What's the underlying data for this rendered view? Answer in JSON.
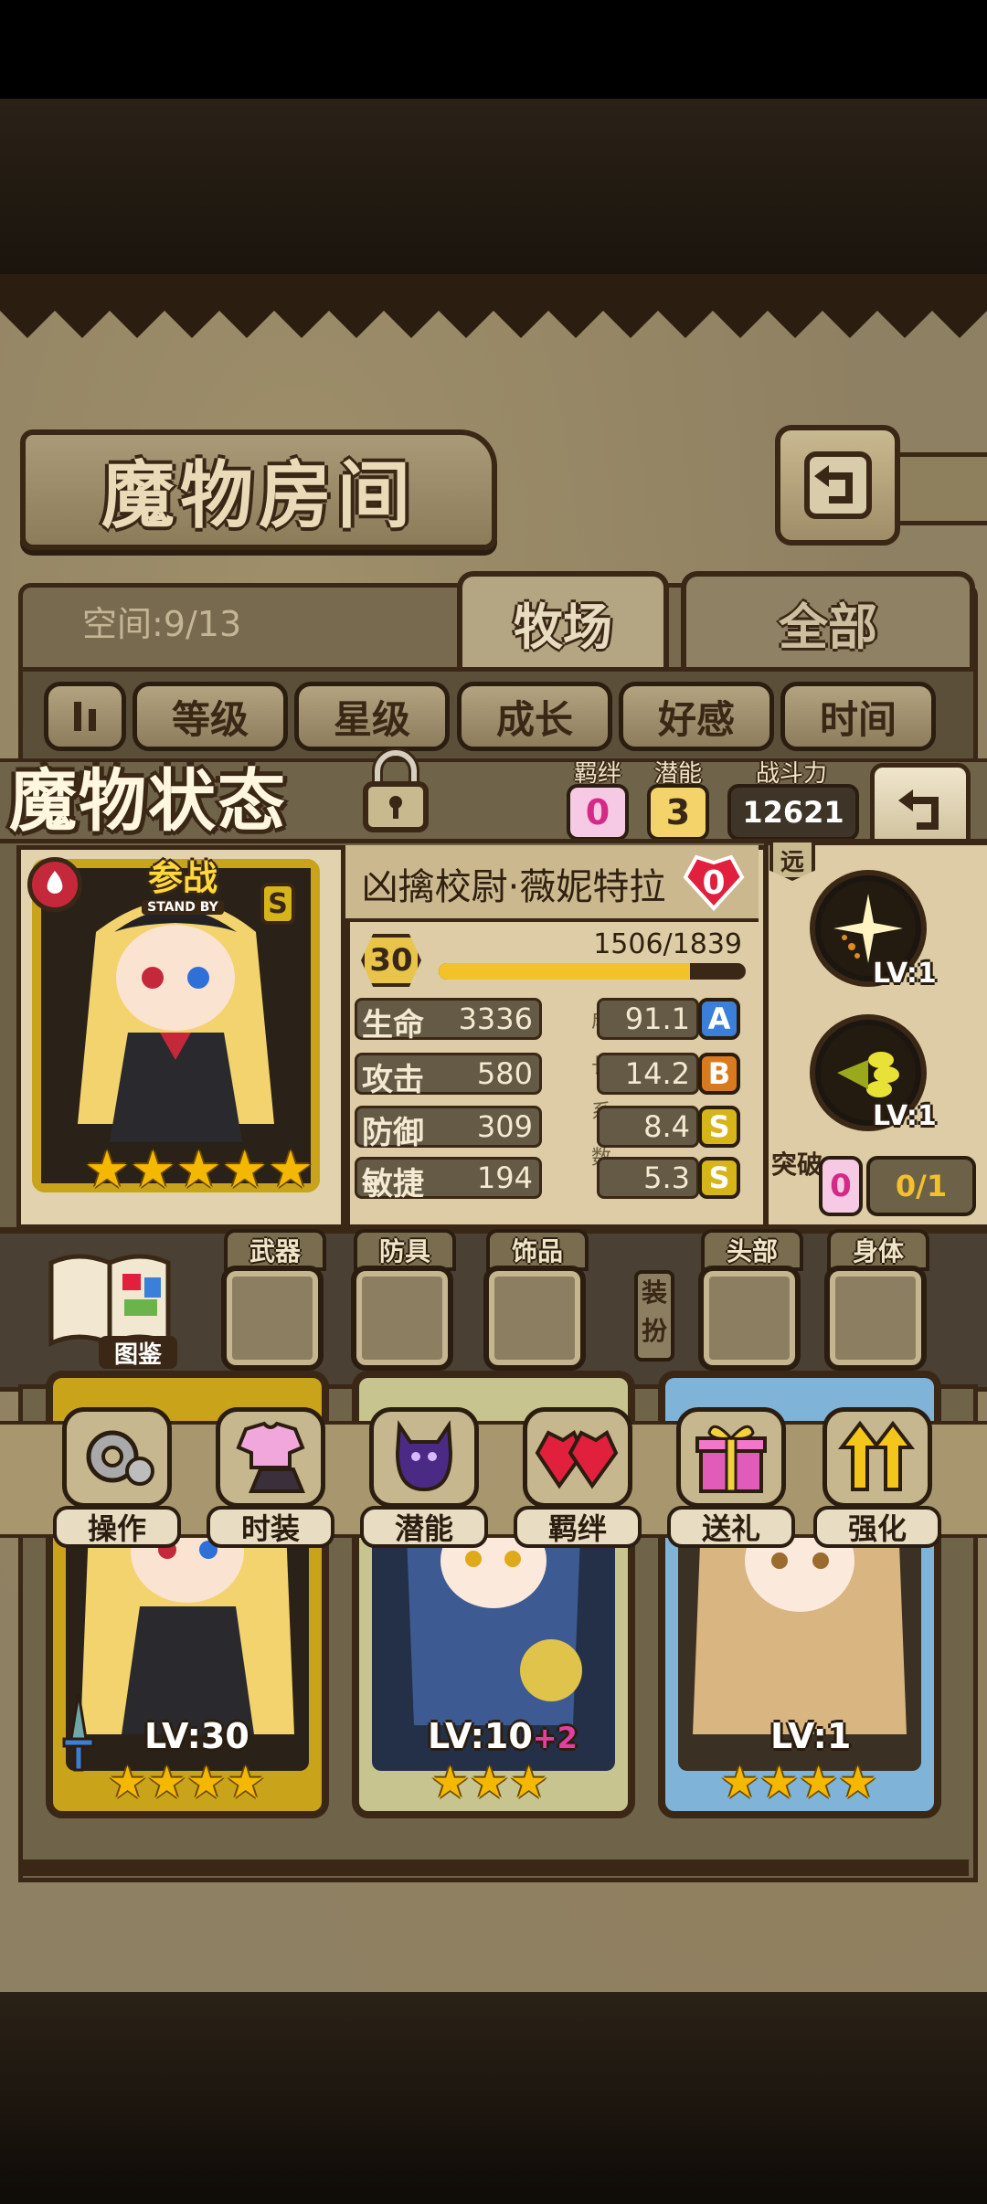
{
  "page": {
    "title": "魔物房间",
    "space": "空间:9/13"
  },
  "tabs": [
    {
      "label": "牧场"
    },
    {
      "label": "全部"
    }
  ],
  "filters": [
    "等级",
    "星级",
    "成长",
    "好感",
    "时间"
  ],
  "status": {
    "title": "魔物状态",
    "bond_label": "羁绊",
    "bond_value": "0",
    "potential_label": "潜能",
    "potential_value": "3",
    "power_label": "战斗力",
    "power_value": "12621"
  },
  "character": {
    "badge": "参战",
    "badge_en": "STAND BY",
    "rank": "S",
    "stars": "★★★★★",
    "name": "凶擒校尉·薇妮特拉",
    "favor": "0",
    "level": "30",
    "exp": "1506/1839",
    "exp_fraction": 0.819,
    "growth_label": [
      "成",
      "长",
      "系",
      "数"
    ],
    "stats": [
      {
        "label": "生命",
        "value": "3336",
        "coef": "91.1",
        "grade": "A",
        "grade_color": "#3a7fd8"
      },
      {
        "label": "攻击",
        "value": "580",
        "coef": "14.2",
        "grade": "B",
        "grade_color": "#d87b1f"
      },
      {
        "label": "防御",
        "value": "309",
        "coef": "8.4",
        "grade": "S",
        "grade_color": "#d6b51a"
      },
      {
        "label": "敏捷",
        "value": "194",
        "coef": "5.3",
        "grade": "S",
        "grade_color": "#d6b51a"
      }
    ]
  },
  "skills": {
    "range": "远",
    "items": [
      {
        "level": "LV:1"
      },
      {
        "level": "LV:1"
      }
    ],
    "breakthrough_label": "突破",
    "breakthrough_value": "0",
    "breakthrough_progress": "0/1"
  },
  "equipment": {
    "codex_label": "图鉴",
    "slots": [
      "武器",
      "防具",
      "饰品",
      "头部",
      "身体"
    ],
    "dress_label": "装扮"
  },
  "actions": [
    "操作",
    "时装",
    "潜能",
    "羁绊",
    "送礼",
    "强化"
  ],
  "monsters": [
    {
      "level": "LV:30",
      "stars": "★★★★"
    },
    {
      "level": "LV:10",
      "bonus": "+2",
      "stars": "★★★"
    },
    {
      "level": "LV:1",
      "stars": "★★★★"
    }
  ],
  "colors": {
    "gold": "#c9a41b",
    "brown": "#3a2716",
    "parchment": "#ddcca5"
  }
}
